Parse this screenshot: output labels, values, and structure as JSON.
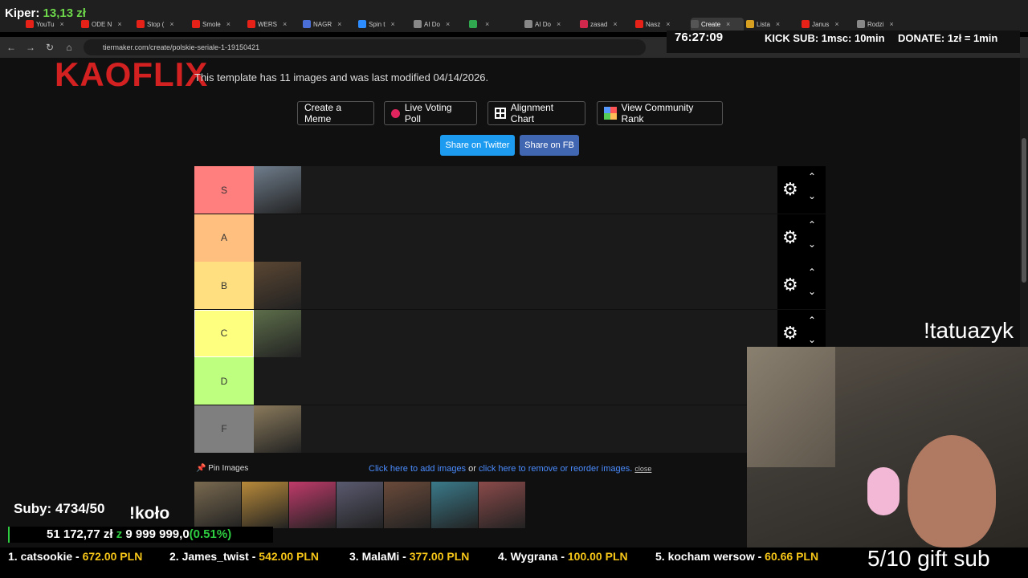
{
  "browser": {
    "tabs": [
      {
        "label": "YouTu",
        "color": "#e62117"
      },
      {
        "label": "ODE N",
        "color": "#e62117"
      },
      {
        "label": "Stop (",
        "color": "#e62117"
      },
      {
        "label": "Smole",
        "color": "#e62117"
      },
      {
        "label": "WERS",
        "color": "#e62117"
      },
      {
        "label": "NAGR",
        "color": "#4a6fd8"
      },
      {
        "label": "Spin t",
        "color": "#2d8cff"
      },
      {
        "label": "AI Do",
        "color": "#888888"
      },
      {
        "label": "",
        "color": "#2fa84f"
      },
      {
        "label": "AI Do",
        "color": "#888888"
      },
      {
        "label": "zasad",
        "color": "#d0284c"
      },
      {
        "label": "Nasz",
        "color": "#e62117"
      },
      {
        "label": "Create",
        "color": "#555555"
      },
      {
        "label": "Lista",
        "color": "#d8a020"
      },
      {
        "label": "Janus",
        "color": "#e62117"
      },
      {
        "label": "Rodzi",
        "color": "#888888"
      }
    ],
    "url": "tiermaker.com/create/polskie-seriale-1-19150421"
  },
  "overlay": {
    "kiper_label": "Kiper:",
    "kiper_value": "13,13 zł",
    "timer": "76:27:09",
    "kick_sub": "KICK SUB: 1msc: 10min",
    "donate": "DONATE: 1zł = 1min",
    "tatu": "!tatuazyk",
    "gift": "5/10 gift sub",
    "subs": "Suby: 4734/50",
    "kolo": "!koło",
    "money_raised": "51 172,77 zł",
    "money_z": "z",
    "money_goal": "9 999 999,0",
    "money_pct": "(0.51%)",
    "money_progress": 0.0051,
    "ticker": [
      {
        "name": "1. catsookie - ",
        "amount": "672.00 PLN"
      },
      {
        "name": "2. James_twist - ",
        "amount": "542.00 PLN"
      },
      {
        "name": "3. MalaMi - ",
        "amount": "377.00 PLN"
      },
      {
        "name": "4. Wygrana - ",
        "amount": "100.00 PLN"
      },
      {
        "name": "5. kocham wersow - ",
        "amount": "60.66 PLN"
      }
    ]
  },
  "page": {
    "logo": "KAOFLIX",
    "template_info": "This template has 11 images and was last modified 04/14/2026.",
    "buttons": {
      "meme": "Create a Meme",
      "poll": "Live Voting Poll",
      "alignment": "Alignment Chart",
      "community": "View Community Rank",
      "twitter": "Share on Twitter",
      "fb": "Share on FB"
    },
    "tiers": [
      {
        "label": "S",
        "color": "#ff7f7f",
        "items": 1
      },
      {
        "label": "A",
        "color": "#ffbf7f",
        "items": 0
      },
      {
        "label": "B",
        "color": "#ffdf7f",
        "items": 1
      },
      {
        "label": "C",
        "color": "#ffff7f",
        "items": 1
      },
      {
        "label": "D",
        "color": "#bfff7f",
        "items": 0
      },
      {
        "label": "F",
        "color": "#7f7f7f",
        "items": 1
      }
    ],
    "pin_images": "Pin Images",
    "add_images": "Click here to add images",
    "or": " or ",
    "remove_images": "click here to remove or reorder images.",
    "close": "close"
  },
  "icons": [
    "back-icon",
    "forward-icon",
    "reload-icon",
    "home-icon",
    "gear-icon",
    "chevron-up-icon",
    "chevron-down-icon",
    "pin-icon",
    "grid-icon"
  ]
}
